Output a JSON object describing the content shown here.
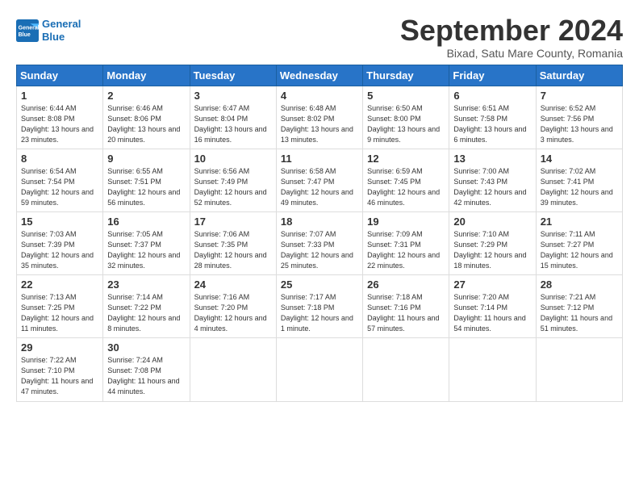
{
  "header": {
    "logo_line1": "General",
    "logo_line2": "Blue",
    "title": "September 2024",
    "subtitle": "Bixad, Satu Mare County, Romania"
  },
  "calendar": {
    "days_of_week": [
      "Sunday",
      "Monday",
      "Tuesday",
      "Wednesday",
      "Thursday",
      "Friday",
      "Saturday"
    ],
    "weeks": [
      [
        {
          "day": "",
          "empty": true
        },
        {
          "day": "",
          "empty": true
        },
        {
          "day": "",
          "empty": true
        },
        {
          "day": "",
          "empty": true
        },
        {
          "day": "",
          "empty": true
        },
        {
          "day": "",
          "empty": true
        },
        {
          "day": "",
          "empty": true
        }
      ],
      [
        {
          "day": "1",
          "sunrise": "6:44 AM",
          "sunset": "8:08 PM",
          "daylight": "13 hours and 23 minutes"
        },
        {
          "day": "2",
          "sunrise": "6:46 AM",
          "sunset": "8:06 PM",
          "daylight": "13 hours and 20 minutes"
        },
        {
          "day": "3",
          "sunrise": "6:47 AM",
          "sunset": "8:04 PM",
          "daylight": "13 hours and 16 minutes"
        },
        {
          "day": "4",
          "sunrise": "6:48 AM",
          "sunset": "8:02 PM",
          "daylight": "13 hours and 13 minutes"
        },
        {
          "day": "5",
          "sunrise": "6:50 AM",
          "sunset": "8:00 PM",
          "daylight": "13 hours and 9 minutes"
        },
        {
          "day": "6",
          "sunrise": "6:51 AM",
          "sunset": "7:58 PM",
          "daylight": "13 hours and 6 minutes"
        },
        {
          "day": "7",
          "sunrise": "6:52 AM",
          "sunset": "7:56 PM",
          "daylight": "13 hours and 3 minutes"
        }
      ],
      [
        {
          "day": "8",
          "sunrise": "6:54 AM",
          "sunset": "7:54 PM",
          "daylight": "12 hours and 59 minutes"
        },
        {
          "day": "9",
          "sunrise": "6:55 AM",
          "sunset": "7:51 PM",
          "daylight": "12 hours and 56 minutes"
        },
        {
          "day": "10",
          "sunrise": "6:56 AM",
          "sunset": "7:49 PM",
          "daylight": "12 hours and 52 minutes"
        },
        {
          "day": "11",
          "sunrise": "6:58 AM",
          "sunset": "7:47 PM",
          "daylight": "12 hours and 49 minutes"
        },
        {
          "day": "12",
          "sunrise": "6:59 AM",
          "sunset": "7:45 PM",
          "daylight": "12 hours and 46 minutes"
        },
        {
          "day": "13",
          "sunrise": "7:00 AM",
          "sunset": "7:43 PM",
          "daylight": "12 hours and 42 minutes"
        },
        {
          "day": "14",
          "sunrise": "7:02 AM",
          "sunset": "7:41 PM",
          "daylight": "12 hours and 39 minutes"
        }
      ],
      [
        {
          "day": "15",
          "sunrise": "7:03 AM",
          "sunset": "7:39 PM",
          "daylight": "12 hours and 35 minutes"
        },
        {
          "day": "16",
          "sunrise": "7:05 AM",
          "sunset": "7:37 PM",
          "daylight": "12 hours and 32 minutes"
        },
        {
          "day": "17",
          "sunrise": "7:06 AM",
          "sunset": "7:35 PM",
          "daylight": "12 hours and 28 minutes"
        },
        {
          "day": "18",
          "sunrise": "7:07 AM",
          "sunset": "7:33 PM",
          "daylight": "12 hours and 25 minutes"
        },
        {
          "day": "19",
          "sunrise": "7:09 AM",
          "sunset": "7:31 PM",
          "daylight": "12 hours and 22 minutes"
        },
        {
          "day": "20",
          "sunrise": "7:10 AM",
          "sunset": "7:29 PM",
          "daylight": "12 hours and 18 minutes"
        },
        {
          "day": "21",
          "sunrise": "7:11 AM",
          "sunset": "7:27 PM",
          "daylight": "12 hours and 15 minutes"
        }
      ],
      [
        {
          "day": "22",
          "sunrise": "7:13 AM",
          "sunset": "7:25 PM",
          "daylight": "12 hours and 11 minutes"
        },
        {
          "day": "23",
          "sunrise": "7:14 AM",
          "sunset": "7:22 PM",
          "daylight": "12 hours and 8 minutes"
        },
        {
          "day": "24",
          "sunrise": "7:16 AM",
          "sunset": "7:20 PM",
          "daylight": "12 hours and 4 minutes"
        },
        {
          "day": "25",
          "sunrise": "7:17 AM",
          "sunset": "7:18 PM",
          "daylight": "12 hours and 1 minute"
        },
        {
          "day": "26",
          "sunrise": "7:18 AM",
          "sunset": "7:16 PM",
          "daylight": "11 hours and 57 minutes"
        },
        {
          "day": "27",
          "sunrise": "7:20 AM",
          "sunset": "7:14 PM",
          "daylight": "11 hours and 54 minutes"
        },
        {
          "day": "28",
          "sunrise": "7:21 AM",
          "sunset": "7:12 PM",
          "daylight": "11 hours and 51 minutes"
        }
      ],
      [
        {
          "day": "29",
          "sunrise": "7:22 AM",
          "sunset": "7:10 PM",
          "daylight": "11 hours and 47 minutes"
        },
        {
          "day": "30",
          "sunrise": "7:24 AM",
          "sunset": "7:08 PM",
          "daylight": "11 hours and 44 minutes"
        },
        {
          "day": "",
          "empty": true
        },
        {
          "day": "",
          "empty": true
        },
        {
          "day": "",
          "empty": true
        },
        {
          "day": "",
          "empty": true
        },
        {
          "day": "",
          "empty": true
        }
      ]
    ]
  }
}
